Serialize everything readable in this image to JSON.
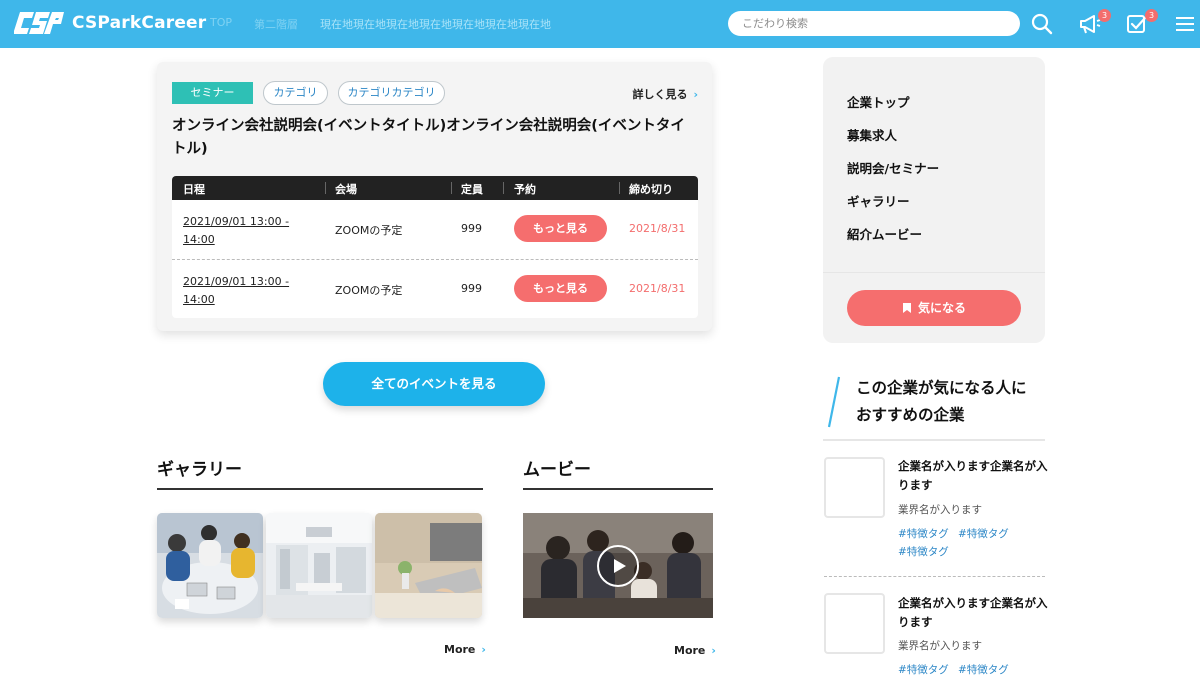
{
  "header": {
    "logo_mark": "CSP",
    "logo_text": "CSParkCareer",
    "nav": [
      "TOP",
      "第二階層"
    ],
    "nav_current": "現在地現在地現在地現在地現在地現在地現在地",
    "search_placeholder": "こだわり検索",
    "notification_count": "3",
    "task_count": "3",
    "accent_color": "#3fb7ea"
  },
  "event": {
    "type_tag": "セミナー",
    "categories": [
      "カテゴリ",
      "カテゴリカテゴリ"
    ],
    "more_label": "詳しく見る",
    "title": "オンライン会社説明会(イベントタイトル)オンライン会社説明会(イベントタイトル)",
    "table": {
      "headers": [
        "日程",
        "会場",
        "定員",
        "予約",
        "締め切り"
      ],
      "rows": [
        {
          "date": "2021/09/01 13:00 -",
          "date2": "14:00",
          "venue": "ZOOMの予定",
          "capacity": "999",
          "reserve": "もっと見る",
          "deadline": "2021/8/31"
        },
        {
          "date": "2021/09/01 13:00 -",
          "date2": "14:00",
          "venue": "ZOOMの予定",
          "capacity": "999",
          "reserve": "もっと見る",
          "deadline": "2021/8/31"
        }
      ]
    },
    "all_events_label": "全てのイベントを見る"
  },
  "gallery": {
    "heading": "ギャラリー",
    "more_label": "More"
  },
  "movie": {
    "heading": "ムービー",
    "more_label": "More"
  },
  "sidebar": {
    "nav_items": [
      "企業トップ",
      "募集求人",
      "説明会/セミナー",
      "ギャラリー",
      "紹介ムービー"
    ],
    "favorite_label": "気になる",
    "recommend_title_line1": "この企業が気になる人に",
    "recommend_title_line2": "おすすめの企業",
    "companies": [
      {
        "name": "企業名が入ります企業名が入ります",
        "industry": "業界名が入ります",
        "tags": [
          "#特徴タグ",
          "#特徴タグ",
          "#特徴タグ"
        ]
      },
      {
        "name": "企業名が入ります企業名が入ります",
        "industry": "業界名が入ります",
        "tags": [
          "#特徴タグ",
          "#特徴タグ"
        ]
      }
    ]
  }
}
